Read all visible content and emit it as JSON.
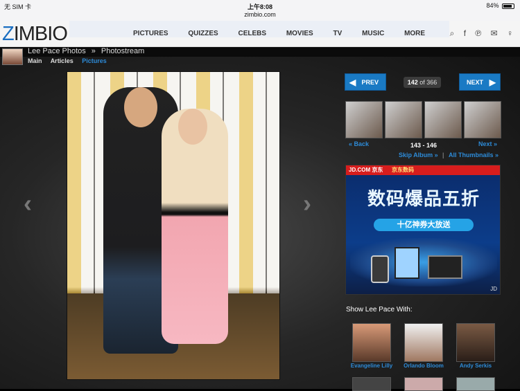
{
  "status": {
    "carrier": "无 SIM 卡",
    "time": "上午8:08",
    "url": "zimbio.com",
    "battery": "84%",
    "battery_level": 0.84
  },
  "nav": {
    "logo": "ZIMBIO",
    "items": [
      "PICTURES",
      "QUIZZES",
      "CELEBS",
      "MOVIES",
      "TV",
      "MUSIC",
      "MORE"
    ]
  },
  "page": {
    "breadcrumb_person": "Lee Pace Photos",
    "breadcrumb_sep": "»",
    "breadcrumb_section": "Photostream",
    "tabs": [
      "Main",
      "Articles",
      "Pictures"
    ]
  },
  "gallery": {
    "prev_label": "PREV",
    "next_label": "NEXT",
    "current": "142",
    "of_label": "of 366",
    "range": "143 - 146",
    "back_label": "« Back",
    "next_link": "Next »",
    "skip_album": "Skip Album »",
    "separator": "|",
    "all_thumbnails": "All Thumbnails »"
  },
  "ad": {
    "brand1": "JD.COM 京东",
    "brand2": "京东数码",
    "headline": "数码爆品五折",
    "subline": "十亿神券大放送",
    "footer": "JD"
  },
  "related": {
    "heading": "Show Lee Pace With:",
    "people": [
      "Evangeline Lilly",
      "Orlando Bloom",
      "Andy Serkis"
    ]
  }
}
